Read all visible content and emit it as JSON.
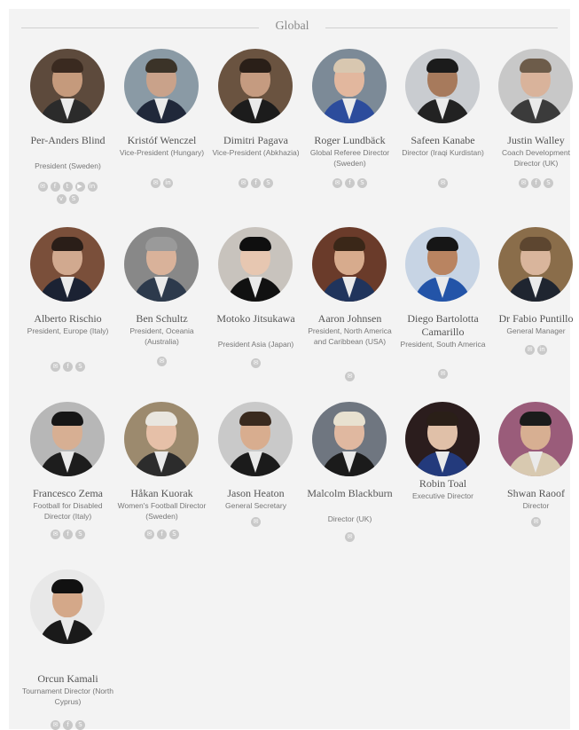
{
  "section": {
    "title": "Global"
  },
  "members": [
    {
      "name": "Per-Anders Blind",
      "role": "President (Sweden)",
      "icons": [
        "email-icon",
        "facebook-icon",
        "twitter-icon",
        "youtube-icon",
        "linkedin-icon",
        "vimeo-icon",
        "skype-icon"
      ]
    },
    {
      "name": "Kristóf Wenczel",
      "role": "Vice-President (Hungary)",
      "icons": [
        "email-icon",
        "linkedin-icon"
      ]
    },
    {
      "name": "Dimitri Pagava",
      "role": "Vice-President (Abkhazia)",
      "icons": [
        "email-icon",
        "facebook-icon",
        "skype-icon"
      ]
    },
    {
      "name": "Roger Lundbäck",
      "role": "Global Referee Director (Sweden)",
      "icons": [
        "email-icon",
        "facebook-icon",
        "skype-icon"
      ]
    },
    {
      "name": "Safeen Kanabe",
      "role": "Director (Iraqi Kurdistan)",
      "icons": [
        "email-icon"
      ]
    },
    {
      "name": "Justin Walley",
      "role": "Coach Development Director (UK)",
      "icons": [
        "email-icon",
        "facebook-icon",
        "skype-icon"
      ]
    },
    {
      "name": "Alberto Rischio",
      "role": "President, Europe (Italy)",
      "icons": [
        "email-icon",
        "facebook-icon",
        "skype-icon"
      ]
    },
    {
      "name": "Ben Schultz",
      "role": "President, Oceania (Australia)",
      "icons": [
        "email-icon"
      ]
    },
    {
      "name": "Motoko Jitsukawa",
      "role": "President Asia (Japan)",
      "icons": [
        "email-icon"
      ]
    },
    {
      "name": "Aaron Johnsen",
      "role": "President, North America and Caribbean (USA)",
      "icons": [
        "email-icon"
      ]
    },
    {
      "name": "Diego Bartolotta Camarillo",
      "role": "President, South America",
      "icons": [
        "email-icon"
      ]
    },
    {
      "name": "Dr Fabio Puntillo",
      "role": "General Manager",
      "icons": [
        "email-icon",
        "linkedin-icon"
      ]
    },
    {
      "name": "Francesco Zema",
      "role": "Football for Disabled Director (Italy)",
      "icons": [
        "email-icon",
        "facebook-icon",
        "skype-icon"
      ]
    },
    {
      "name": "Håkan Kuorak",
      "role": "Women's Football Director (Sweden)",
      "icons": [
        "email-icon",
        "facebook-icon",
        "skype-icon"
      ]
    },
    {
      "name": "Jason Heaton",
      "role": "General Secretary",
      "icons": [
        "email-icon"
      ]
    },
    {
      "name": "Malcolm Blackburn",
      "role": "Director (UK)",
      "icons": [
        "email-icon"
      ]
    },
    {
      "name": "Robin Toal",
      "role": "Executive Director",
      "icons": []
    },
    {
      "name": "Shwan Raoof",
      "role": "Director",
      "icons": [
        "email-icon"
      ]
    },
    {
      "name": "Orcun Kamali",
      "role": "Tournament Director (North Cyprus)",
      "icons": [
        "email-icon",
        "facebook-icon",
        "skype-icon"
      ]
    }
  ]
}
